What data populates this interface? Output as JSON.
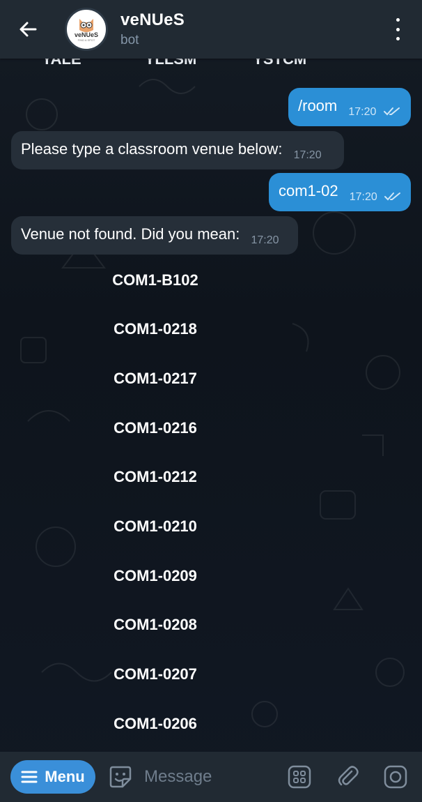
{
  "header": {
    "title": "veNUeS",
    "subtitle": "bot",
    "avatar_logo_text": "veNUeS",
    "avatar_logo_sub": "FIND A SPOT"
  },
  "top_keyboard_row": [
    "YALE",
    "YLLSM",
    "YSTCM"
  ],
  "messages": [
    {
      "direction": "out",
      "text": "/room",
      "time": "17:20",
      "read": true
    },
    {
      "direction": "in",
      "text": "Please type a classroom venue below:",
      "time": "17:20"
    },
    {
      "direction": "out",
      "text": "com1-02",
      "time": "17:20",
      "read": true
    },
    {
      "direction": "in",
      "text": "Venue not found. Did you mean:",
      "time": "17:20"
    }
  ],
  "reply_keyboard": [
    "COM1-B102",
    "COM1-0218",
    "COM1-0217",
    "COM1-0216",
    "COM1-0212",
    "COM1-0210",
    "COM1-0209",
    "COM1-0208",
    "COM1-0207",
    "COM1-0206"
  ],
  "bottom_bar": {
    "menu_label": "Menu",
    "message_placeholder": "Message"
  },
  "colors": {
    "outgoing_bubble": "#2b8fd6",
    "incoming_bubble": "#262f39",
    "header": "#212a33",
    "menu_button": "#3a8fd9"
  },
  "icons": [
    "back-arrow-icon",
    "more-vertical-icon",
    "menu-lines-icon",
    "sticker-icon",
    "bot-commands-icon",
    "attach-icon",
    "camera-icon",
    "double-check-icon"
  ]
}
